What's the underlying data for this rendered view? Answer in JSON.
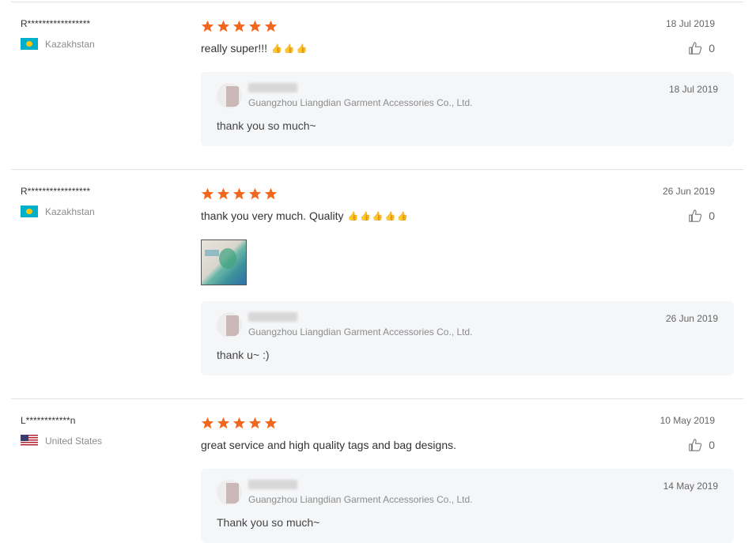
{
  "colors": {
    "star": "#f4661b",
    "reply_bg": "#f5f6f8",
    "divider": "#e3e3e3"
  },
  "icons": {
    "star": "star-icon",
    "thumb": "thumbs-up-icon"
  },
  "reviews": [
    {
      "buyer": "R*****************",
      "country": "Kazakhstan",
      "flag": "kz",
      "rating": 5,
      "text": "really super!!!",
      "hands": "👍👍👍",
      "date": "18 Jul 2019",
      "helpful_count": "0",
      "reply": {
        "seller": "Guangzhou Liangdian Garment Accessories Co., Ltd.",
        "date": "18 Jul 2019",
        "text": "thank you so much~"
      }
    },
    {
      "buyer": "R*****************",
      "country": "Kazakhstan",
      "flag": "kz",
      "rating": 5,
      "text": "thank you very much. Quality",
      "hands": "👍👍👍👍👍",
      "date": "26 Jun 2019",
      "helpful_count": "0",
      "reply": {
        "seller": "Guangzhou Liangdian Garment Accessories Co., Ltd.",
        "date": "26 Jun 2019",
        "text": "thank u~ :)"
      }
    },
    {
      "buyer": "L************n",
      "country": "United States",
      "flag": "us",
      "rating": 5,
      "text": "great service and high quality tags and bag designs.",
      "hands": "",
      "date": "10 May 2019",
      "helpful_count": "0",
      "reply": {
        "seller": "Guangzhou Liangdian Garment Accessories Co., Ltd.",
        "date": "14 May 2019",
        "text": "Thank you so much~"
      }
    }
  ]
}
